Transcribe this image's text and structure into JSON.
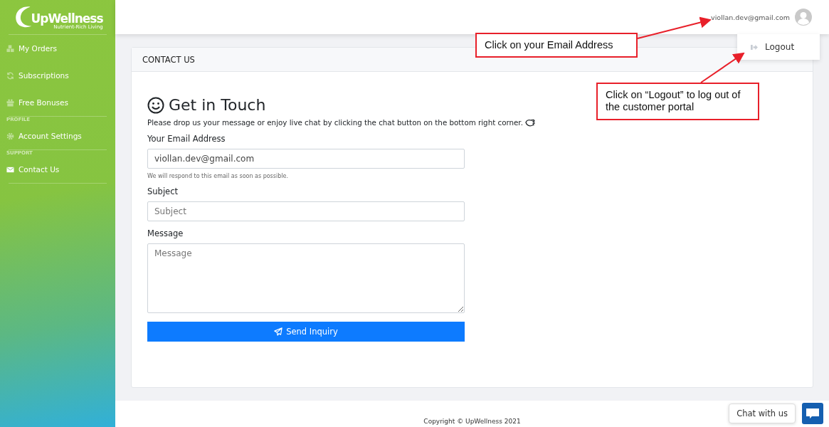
{
  "sidebar": {
    "logo": {
      "name": "UpWellness",
      "tagline": "Nutrient-Rich Living"
    },
    "sections": [
      {
        "items": [
          {
            "label": "My Orders",
            "selected": false
          },
          {
            "label": "Subscriptions",
            "selected": false
          },
          {
            "label": "Free Bonuses",
            "selected": false
          }
        ]
      },
      {
        "heading": "PROFILE",
        "items": [
          {
            "label": "Account Settings",
            "selected": false
          }
        ]
      },
      {
        "heading": "SUPPORT",
        "items": [
          {
            "label": "Contact Us",
            "selected": true
          }
        ]
      }
    ]
  },
  "header": {
    "user_email": "viollan.dev@gmail.com",
    "menu": {
      "items": [
        "Logout"
      ]
    }
  },
  "card": {
    "title": "CONTACT US",
    "heading": "Get in Touch",
    "intro": "Please drop us your message or enjoy live chat by clicking the chat button on the bottom right corner.",
    "fields": [
      {
        "kind": "input",
        "label": "Your Email Address",
        "value": "viollan.dev@gmail.com",
        "help": "We will respond to this email as soon as possible."
      },
      {
        "kind": "input",
        "label": "Subject",
        "placeholder": "Subject"
      },
      {
        "kind": "textarea",
        "label": "Message",
        "placeholder": "Message"
      }
    ],
    "submit": "Send Inquiry"
  },
  "footer": "Copyright © UpWellness 2021",
  "chat": {
    "label": "Chat with us"
  },
  "annotations": [
    {
      "text": "Click on your Email Address"
    },
    {
      "text": "Click on “Logout” to log out of the customer portal"
    }
  ]
}
